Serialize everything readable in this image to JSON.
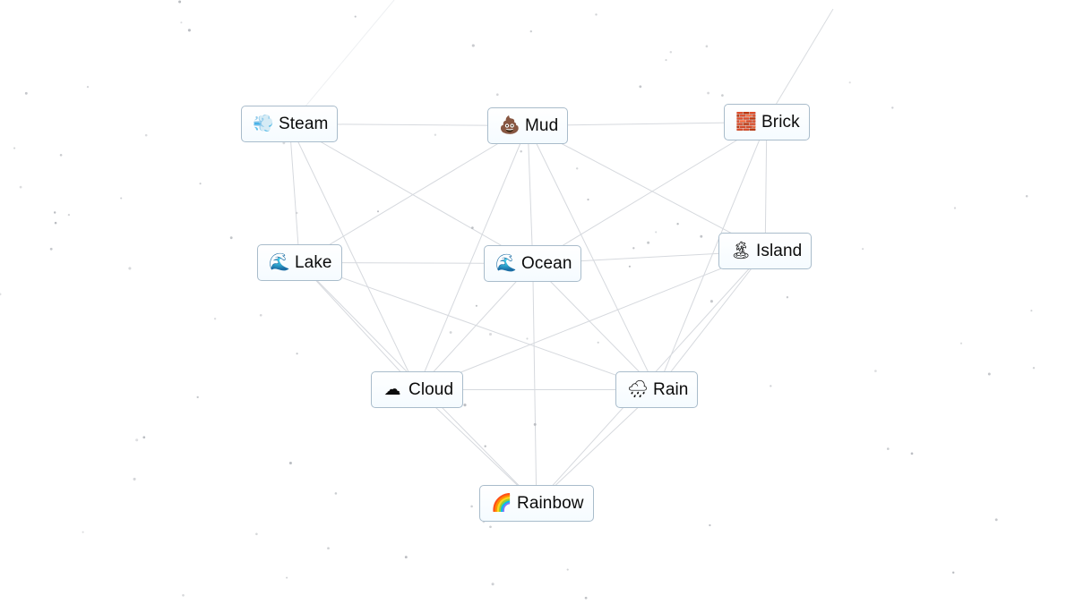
{
  "canvas": {
    "background": "#ffffff",
    "edge_color": "#d6d9de",
    "dot_color": "#b5b8bd"
  },
  "nodes": [
    {
      "id": "steam",
      "label": "Steam",
      "icon": "dashing-away-icon",
      "glyph": "💨"
    },
    {
      "id": "mud",
      "label": "Mud",
      "icon": "pile-of-poo-icon",
      "glyph": "💩"
    },
    {
      "id": "brick",
      "label": "Brick",
      "icon": "brick-icon",
      "glyph": "🧱"
    },
    {
      "id": "lake",
      "label": "Lake",
      "icon": "water-wave-icon",
      "glyph": "🌊"
    },
    {
      "id": "ocean",
      "label": "Ocean",
      "icon": "water-wave-icon",
      "glyph": "🌊"
    },
    {
      "id": "island",
      "label": "Island",
      "icon": "desert-island-icon",
      "glyph": "🏝"
    },
    {
      "id": "cloud",
      "label": "Cloud",
      "icon": "cloud-icon",
      "glyph": "☁"
    },
    {
      "id": "rain",
      "label": "Rain",
      "icon": "cloud-with-rain-icon",
      "glyph": "🌧"
    },
    {
      "id": "rainbow",
      "label": "Rainbow",
      "icon": "rainbow-icon",
      "glyph": "🌈"
    }
  ],
  "edges": [
    [
      "steam",
      "mud"
    ],
    [
      "steam",
      "lake"
    ],
    [
      "steam",
      "cloud"
    ],
    [
      "steam",
      "ocean"
    ],
    [
      "mud",
      "brick"
    ],
    [
      "mud",
      "lake"
    ],
    [
      "mud",
      "ocean"
    ],
    [
      "mud",
      "cloud"
    ],
    [
      "mud",
      "rain"
    ],
    [
      "mud",
      "island"
    ],
    [
      "brick",
      "island"
    ],
    [
      "brick",
      "ocean"
    ],
    [
      "brick",
      "rain"
    ],
    [
      "lake",
      "ocean"
    ],
    [
      "lake",
      "cloud"
    ],
    [
      "lake",
      "rain"
    ],
    [
      "lake",
      "rainbow"
    ],
    [
      "ocean",
      "island"
    ],
    [
      "ocean",
      "cloud"
    ],
    [
      "ocean",
      "rain"
    ],
    [
      "ocean",
      "rainbow"
    ],
    [
      "island",
      "rain"
    ],
    [
      "island",
      "cloud"
    ],
    [
      "island",
      "rainbow"
    ],
    [
      "cloud",
      "rain"
    ],
    [
      "cloud",
      "rainbow"
    ],
    [
      "rain",
      "rainbow"
    ]
  ]
}
